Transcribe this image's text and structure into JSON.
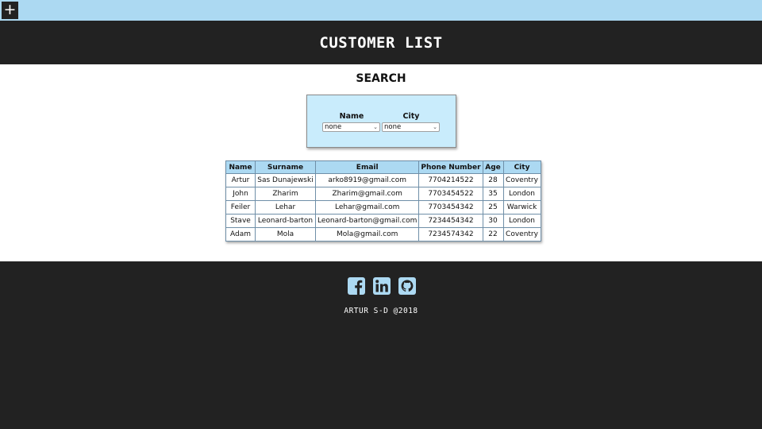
{
  "topbar": {
    "add_label": "+"
  },
  "header": {
    "title": "CUSTOMER LIST"
  },
  "search": {
    "title": "SEARCH",
    "name_label": "Name",
    "name_value": "none",
    "city_label": "City",
    "city_value": "none"
  },
  "table": {
    "headers": [
      "Name",
      "Surname",
      "Email",
      "Phone Number",
      "Age",
      "City"
    ],
    "rows": [
      [
        "Artur",
        "Sas Dunajewski",
        "arko8919@gmail.com",
        "7704214522",
        "28",
        "Coventry"
      ],
      [
        "John",
        "Zharim",
        "Zharim@gmail.com",
        "7703454522",
        "35",
        "London"
      ],
      [
        "Feiler",
        "Lehar",
        "Lehar@gmail.com",
        "7703454342",
        "25",
        "Warwick"
      ],
      [
        "Stave",
        "Leonard-barton",
        "Leonard-barton@gmail.com",
        "7234454342",
        "30",
        "London"
      ],
      [
        "Adam",
        "Mola",
        "Mola@gmail.com",
        "7234574342",
        "22",
        "Coventry"
      ]
    ]
  },
  "footer": {
    "icons": [
      "facebook-icon",
      "linkedin-icon",
      "github-icon"
    ],
    "copyright": "ARTUR S-D @2018"
  },
  "colors": {
    "accent": "#acd9f2",
    "search_bg": "#c9ecfc",
    "dark": "#222222"
  }
}
